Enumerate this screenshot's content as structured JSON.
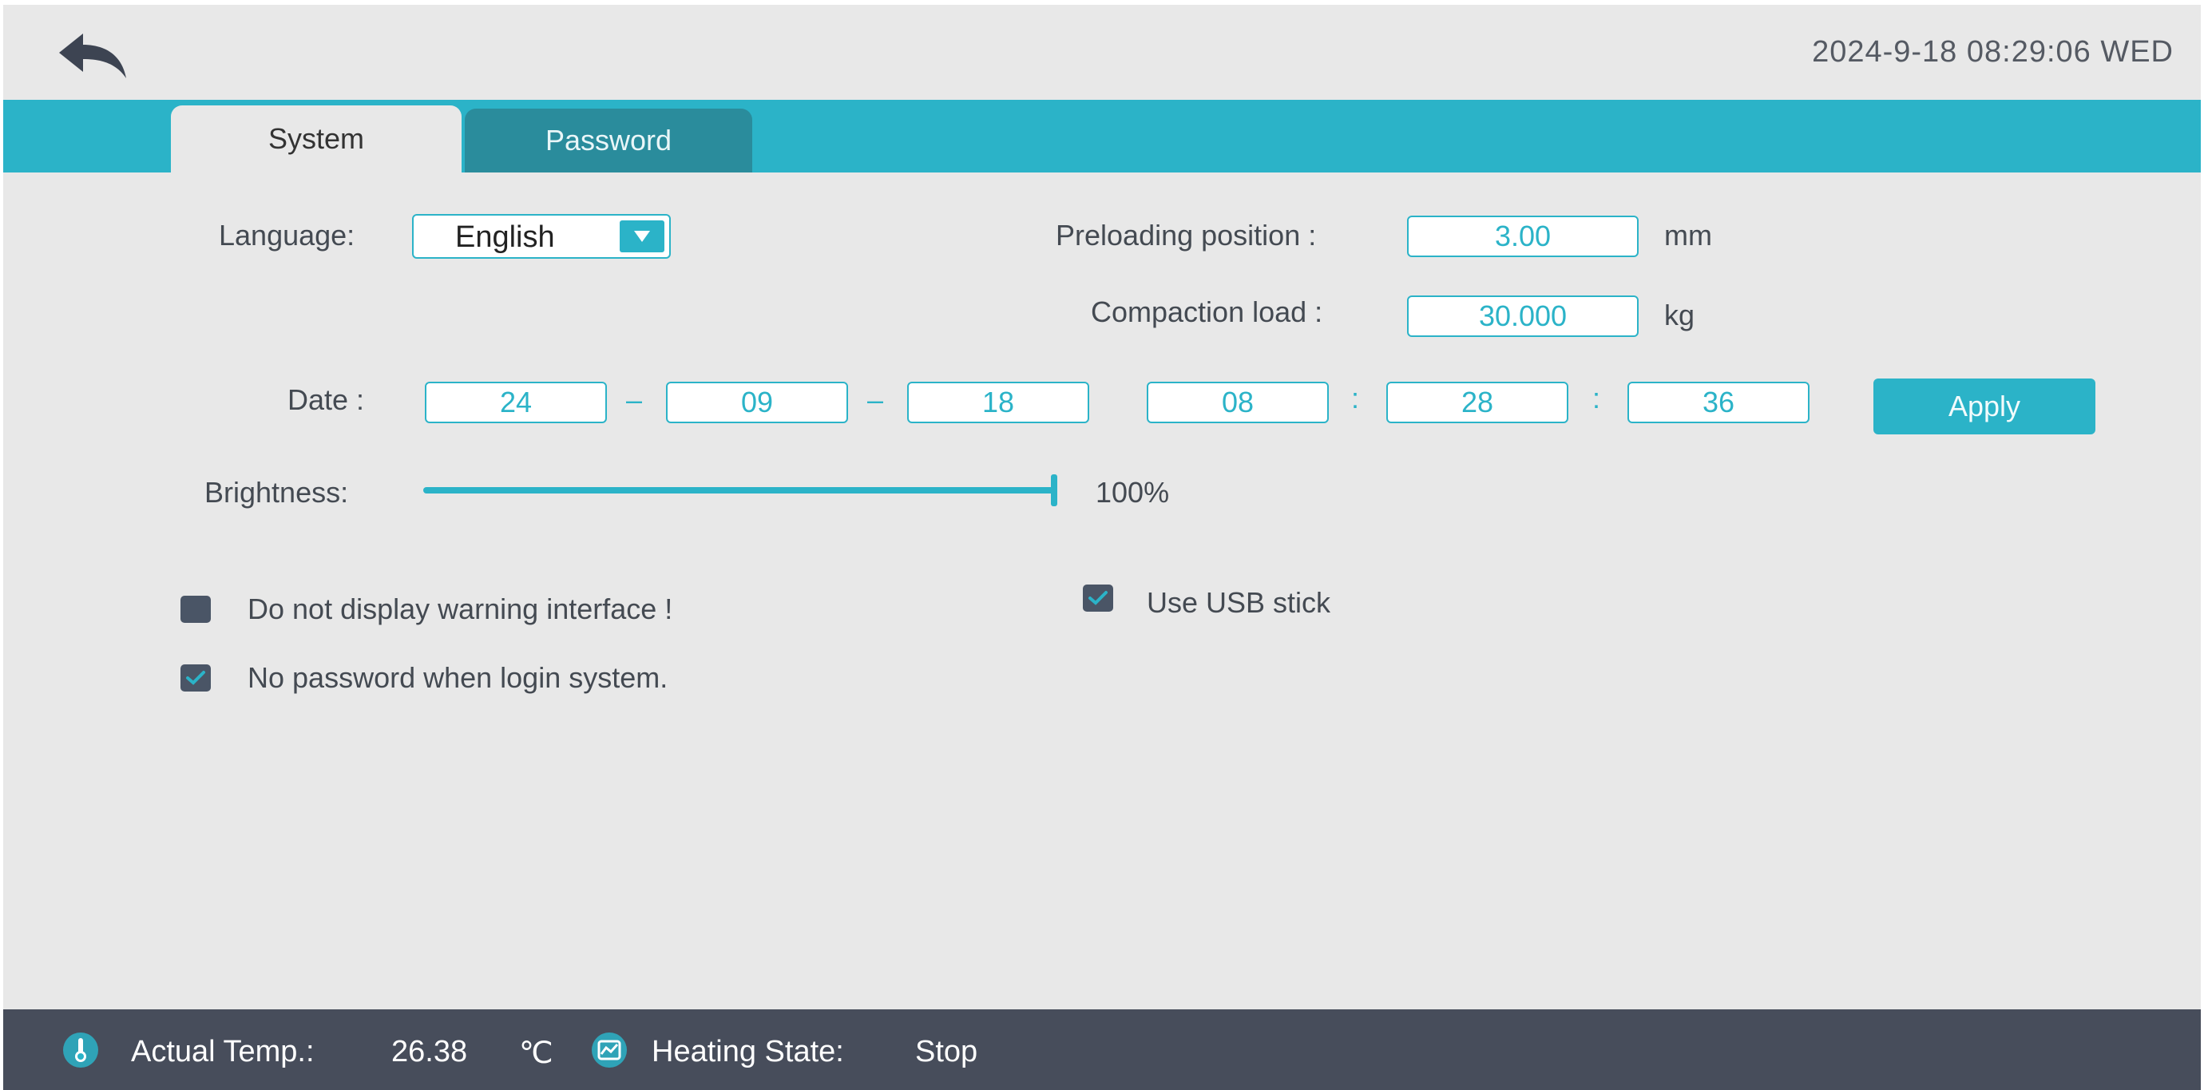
{
  "header": {
    "datetime": "2024-9-18 08:29:06 WED"
  },
  "tabs": [
    {
      "label": "System",
      "active": true
    },
    {
      "label": "Password",
      "active": false
    }
  ],
  "system": {
    "language": {
      "label": "Language:",
      "value": "English"
    },
    "preloading": {
      "label": "Preloading position :",
      "value": "3.00",
      "unit": "mm"
    },
    "compaction": {
      "label": "Compaction load :",
      "value": "30.000",
      "unit": "kg"
    },
    "date": {
      "label": "Date :",
      "year": "24",
      "month": "09",
      "day": "18",
      "hour": "08",
      "minute": "28",
      "second": "36",
      "date_sep": "–",
      "time_sep": ":"
    },
    "apply_label": "Apply",
    "brightness": {
      "label": "Brightness:",
      "value_text": "100%",
      "value": 1.0
    },
    "options": {
      "no_warning": {
        "label": "Do not display warning interface !",
        "checked": false
      },
      "no_password": {
        "label": "No password when login system.",
        "checked": true
      },
      "use_usb": {
        "label": "Use USB stick",
        "checked": true
      }
    }
  },
  "status": {
    "temp_label": "Actual Temp.:",
    "temp_value": "26.38",
    "temp_unit": "℃",
    "heating_label": "Heating State:",
    "heating_value": "Stop"
  },
  "colors": {
    "accent": "#2bb3c8",
    "tab_inactive": "#2a8c9c",
    "statusbar": "#474d5b",
    "background": "#e8e8e8"
  },
  "icons": {
    "back": "back-arrow-icon",
    "temp": "thermometer-icon",
    "heating": "chart-icon",
    "dropdown": "triangle-down-icon",
    "check": "checkmark-icon"
  }
}
